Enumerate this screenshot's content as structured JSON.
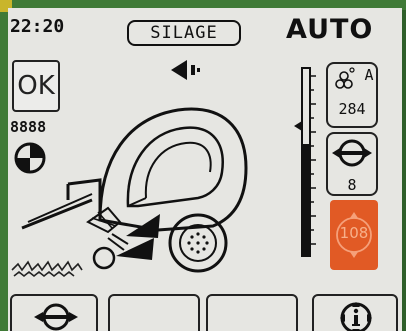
{
  "status": {
    "time": "22:20",
    "crop_mode": "SILAGE",
    "operating_mode": "AUTO"
  },
  "left_controls": {
    "ok_label": "OK",
    "counter_value": "8888"
  },
  "right_panel": {
    "knife_count": "284",
    "knife_label": "A",
    "net_wraps": "8",
    "bale_target": "108"
  },
  "icons": {
    "direction": "arrow-left-icon",
    "bale_net": "net-wrap-icon",
    "knives": "knife-group-icon",
    "info": "info-icon"
  },
  "colors": {
    "screen": "#e6e6e2",
    "indicator": "#e15a25",
    "bezel": "#3f7a36"
  }
}
